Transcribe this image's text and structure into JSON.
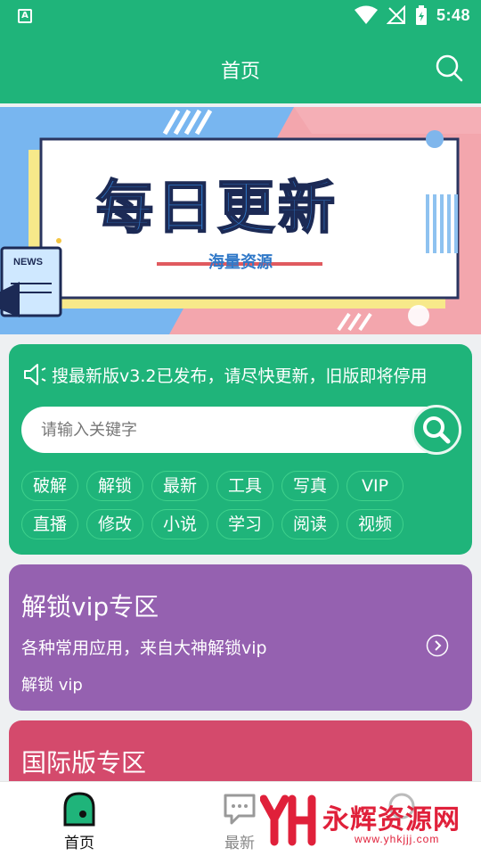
{
  "status_bar": {
    "time": "5:48",
    "notification_letter": "A"
  },
  "app_bar": {
    "title": "首页"
  },
  "banner": {
    "title": "每日更新",
    "subtitle": "海量资源",
    "news_label": "NEWS"
  },
  "notice": {
    "text": "搜最新版v3.2已发布，请尽快更新，旧版即将停用"
  },
  "search": {
    "placeholder": "请输入关键字"
  },
  "tags": [
    [
      "破解",
      "解锁",
      "最新",
      "工具",
      "写真",
      "VIP"
    ],
    [
      "直播",
      "修改",
      "小说",
      "学习",
      "阅读",
      "视频"
    ]
  ],
  "cards": {
    "vip": {
      "title": "解锁vip专区",
      "description": "各种常用应用，来自大神解锁vip",
      "subtitle": "解锁 vip"
    },
    "intl": {
      "title": "国际版专区"
    }
  },
  "bottom_nav": {
    "home": "首页",
    "latest": "最新"
  },
  "watermark": {
    "text": "永辉资源网",
    "url": "www.yhkjjj.com"
  },
  "colors": {
    "primary": "#1fb47a",
    "purple_card": "#9561b0",
    "red_card": "#d44a6c",
    "watermark": "#e0203a"
  }
}
